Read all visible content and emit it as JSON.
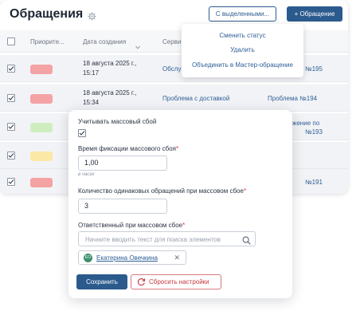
{
  "header": {
    "title": "Обращения",
    "with_selected_label": "С выделенными...",
    "new_request_label": "+ Обращение"
  },
  "table": {
    "columns": [
      "Приорите...",
      "Дата создания",
      "Серви"
    ],
    "rows": [
      {
        "priority_color": "#f4a3a5",
        "date_line1": "18 августа 2025 г.,",
        "date_line2": "15:17",
        "service": "Обслу",
        "link": "№195"
      },
      {
        "priority_color": "#f4a3a5",
        "date_line1": "18 августа 2025 г.,",
        "date_line2": "15:34",
        "service": "Проблема с доставкой",
        "link": "Проблема  №194"
      },
      {
        "priority_color": "#cfeec0",
        "date_line1": "",
        "date_line2": "",
        "service": "",
        "link_line1": "жение по",
        "link_line2": "№193"
      },
      {
        "priority_color": "#fbe8a6",
        "date_line1": "",
        "date_line2": "",
        "service": "",
        "link": ""
      },
      {
        "priority_color": "#f4a3a5",
        "date_line1": "",
        "date_line2": "",
        "service": "",
        "link": "№191"
      }
    ]
  },
  "dropdown": {
    "items": [
      "Сменить статус",
      "Удалить",
      "Объединить в Мастер-обращение"
    ]
  },
  "panel": {
    "mass_failure_label": "Учитывать массовый сбой",
    "mass_failure_checked": true,
    "fix_time_label": "Время фиксации массового сбоя",
    "fix_time_value": "1,00",
    "fix_time_hint": "в часах",
    "count_label": "Количество одинаковых обращений при массовом сбое",
    "count_value": "3",
    "responsible_label": "Ответственный при массовом сбое",
    "search_placeholder": "Начните вводить текст для поиска элементов",
    "chip_initials": "ЕО",
    "chip_name": "Екатерина Овечкина",
    "save_label": "Сохранить",
    "reset_label": "Сбросить настройки",
    "required_mark": "*"
  },
  "colors": {
    "accent": "#2b5a8d",
    "link": "#2e5f97",
    "danger": "#c8373f",
    "priority_high": "#f4a3a5",
    "priority_low": "#cfeec0",
    "priority_medium": "#fbe8a6"
  }
}
